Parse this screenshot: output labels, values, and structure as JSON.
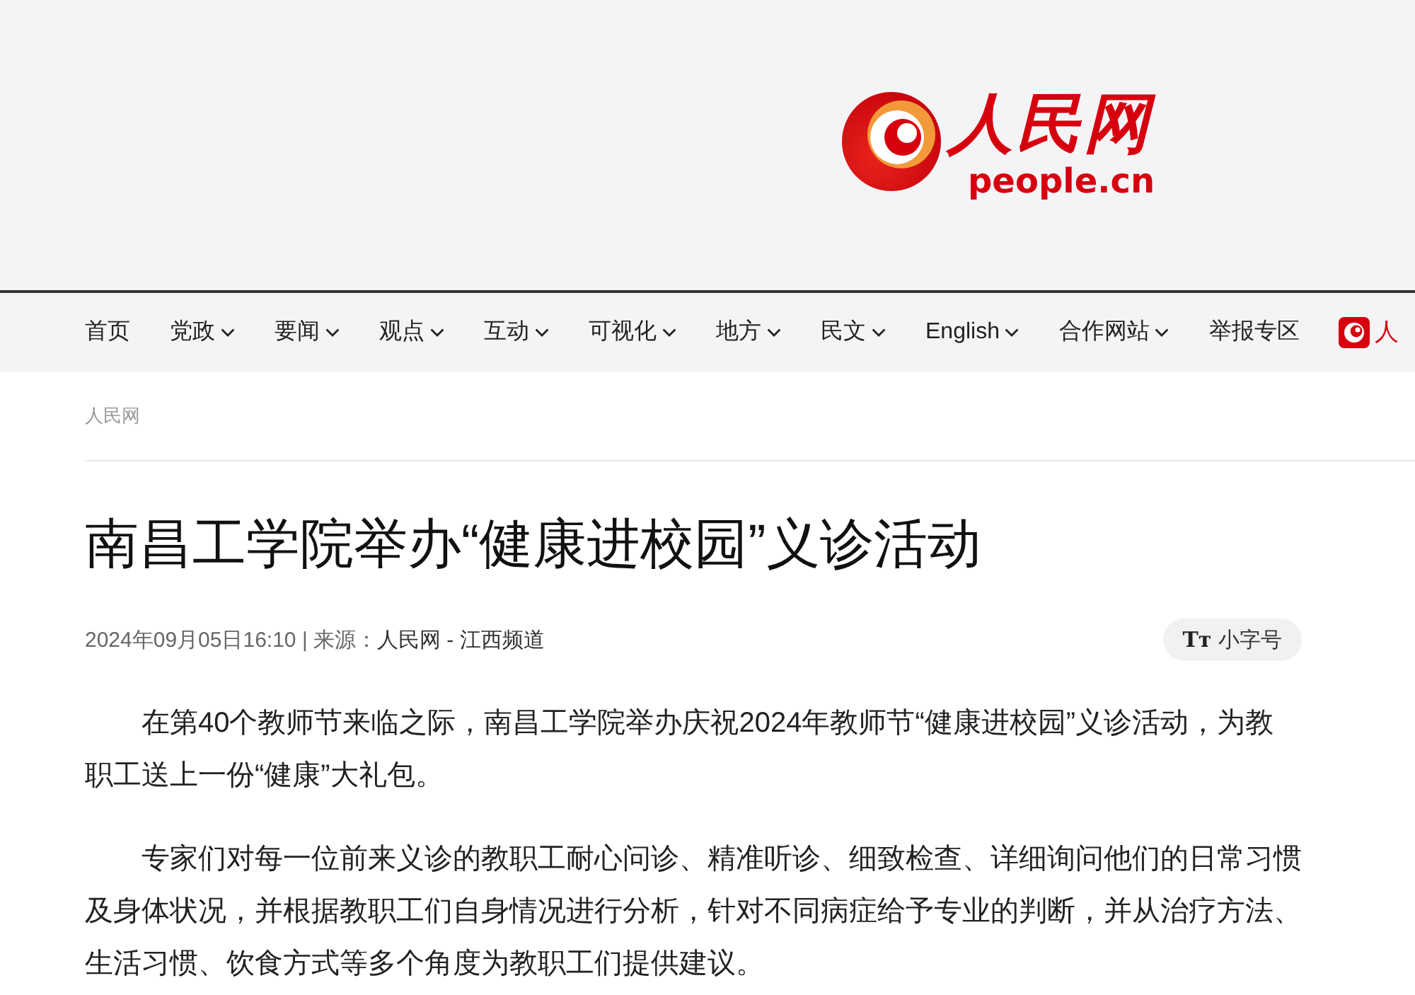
{
  "header": {
    "logo": {
      "name": "人民网",
      "domain": "people.cn"
    }
  },
  "nav": [
    {
      "label": "首页",
      "kind": "link"
    },
    {
      "label": "党政",
      "kind": "dropdown"
    },
    {
      "label": "要闻",
      "kind": "dropdown"
    },
    {
      "label": "观点",
      "kind": "dropdown"
    },
    {
      "label": "互动",
      "kind": "dropdown"
    },
    {
      "label": "可视化",
      "kind": "dropdown"
    },
    {
      "label": "地方",
      "kind": "dropdown"
    },
    {
      "label": "民文",
      "kind": "dropdown"
    },
    {
      "label": "English",
      "kind": "dropdown"
    },
    {
      "label": "合作网站",
      "kind": "dropdown"
    },
    {
      "label": "举报专区",
      "kind": "link"
    },
    {
      "label": "人",
      "kind": "brand"
    }
  ],
  "breadcrumb": [
    "人民网"
  ],
  "article": {
    "title": "南昌工学院举办“健康进校园”义诊活动",
    "meta": {
      "published": "2024年09月05日16:10 | 来源：",
      "source": "人民网 - 江西频道"
    },
    "font_button": {
      "icon": "Tᴛ",
      "label": "小字号"
    },
    "paragraphs": [
      "在第40个教师节来临之际，南昌工学院举办庆祝2024年教师节“健康进校园”义诊活动，为教职工送上一份“健康”大礼包。",
      "专家们对每一位前来义诊的教职工耐心问诊、精准听诊、细致检查、详细询问他们的日常习惯及身体状况，并根据教职工们自身情况进行分析，针对不同病症给予专业的判断，并从治疗方法、生活习惯、饮食方式等多个角度为教职工们提供建议。"
    ]
  }
}
